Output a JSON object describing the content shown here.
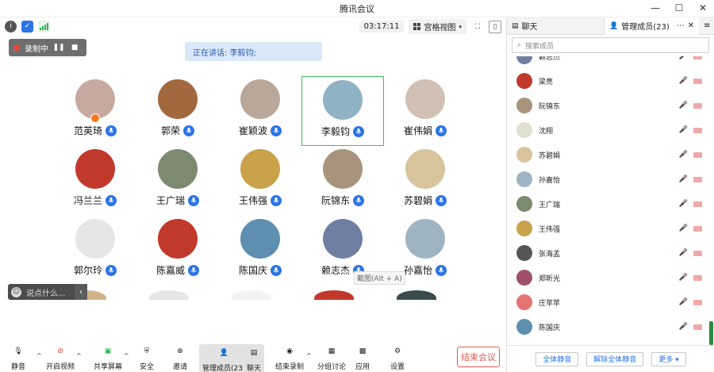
{
  "window": {
    "title": "腾讯会议"
  },
  "topbar": {
    "timer": "03:17:11",
    "view_label": "宫格视图"
  },
  "recording": {
    "label": "录制中"
  },
  "speaking": {
    "text": "正在讲话: 李毅钧;"
  },
  "participants": [
    {
      "name": "范英琦",
      "color": "#c8a9a0"
    },
    {
      "name": "郭荣",
      "color": "#a2683e"
    },
    {
      "name": "崔颖波",
      "color": "#b9a89a"
    },
    {
      "name": "李毅钧",
      "color": "#8fb2c4"
    },
    {
      "name": "崔伟娟",
      "color": "#d0c1b4"
    },
    {
      "name": "冯兰兰",
      "color": "#c0392b"
    },
    {
      "name": "王广瑞",
      "color": "#7c8a70"
    },
    {
      "name": "王伟强",
      "color": "#c9a24a"
    },
    {
      "name": "阮锦东",
      "color": "#a8947c"
    },
    {
      "name": "苏碧娟",
      "color": "#d8c49c"
    },
    {
      "name": "郭尔玲",
      "color": "#e6e6e6"
    },
    {
      "name": "陈嘉威",
      "color": "#c0392b"
    },
    {
      "name": "陈国庆",
      "color": "#5e8fb0"
    },
    {
      "name": "赖志杰",
      "color": "#6f7fa2"
    },
    {
      "name": "孙嘉怡",
      "color": "#9fb4c2"
    }
  ],
  "chat_input": {
    "placeholder": "说点什么..."
  },
  "tooltip": "截图(Alt + A)",
  "toolbar": [
    {
      "label": "静音",
      "icon": "mic-icon"
    },
    {
      "label": "开启视频",
      "icon": "video-off-icon"
    },
    {
      "label": "共享屏幕",
      "icon": "share-screen-icon"
    },
    {
      "label": "安全",
      "icon": "shield-icon"
    },
    {
      "label": "邀请",
      "icon": "invite-icon"
    },
    {
      "label": "管理成员(23)",
      "icon": "members-icon"
    },
    {
      "label": "聊天",
      "icon": "chat-icon"
    },
    {
      "label": "结束录制",
      "icon": "stop-record-icon"
    },
    {
      "label": "分组讨论",
      "icon": "breakout-icon"
    },
    {
      "label": "应用",
      "icon": "apps-icon"
    },
    {
      "label": "设置",
      "icon": "gear-icon"
    }
  ],
  "end_button": "结束会议",
  "panel": {
    "tab_chat": "聊天",
    "tab_members": "管理成员(23)",
    "search_placeholder": "搜索成员",
    "members": [
      {
        "name": "赖志杰",
        "color": "#6f7fa2"
      },
      {
        "name": "梁亮",
        "color": "#c0392b"
      },
      {
        "name": "阮锦东",
        "color": "#a8947c"
      },
      {
        "name": "沈翔",
        "color": "#e0e0d0"
      },
      {
        "name": "苏碧娟",
        "color": "#d8c49c"
      },
      {
        "name": "孙嘉怡",
        "color": "#9fb4c2"
      },
      {
        "name": "王广瑞",
        "color": "#7c8a70"
      },
      {
        "name": "王伟强",
        "color": "#c9a24a"
      },
      {
        "name": "张海孟",
        "color": "#555555"
      },
      {
        "name": "郑昕光",
        "color": "#a0506a"
      },
      {
        "name": "庄苹苹",
        "color": "#e57373"
      },
      {
        "name": "陈国庆",
        "color": "#5e8fb0"
      }
    ],
    "mute_all": "全体静音",
    "unmute_all": "解除全体静音",
    "more": "更多 ▾"
  }
}
